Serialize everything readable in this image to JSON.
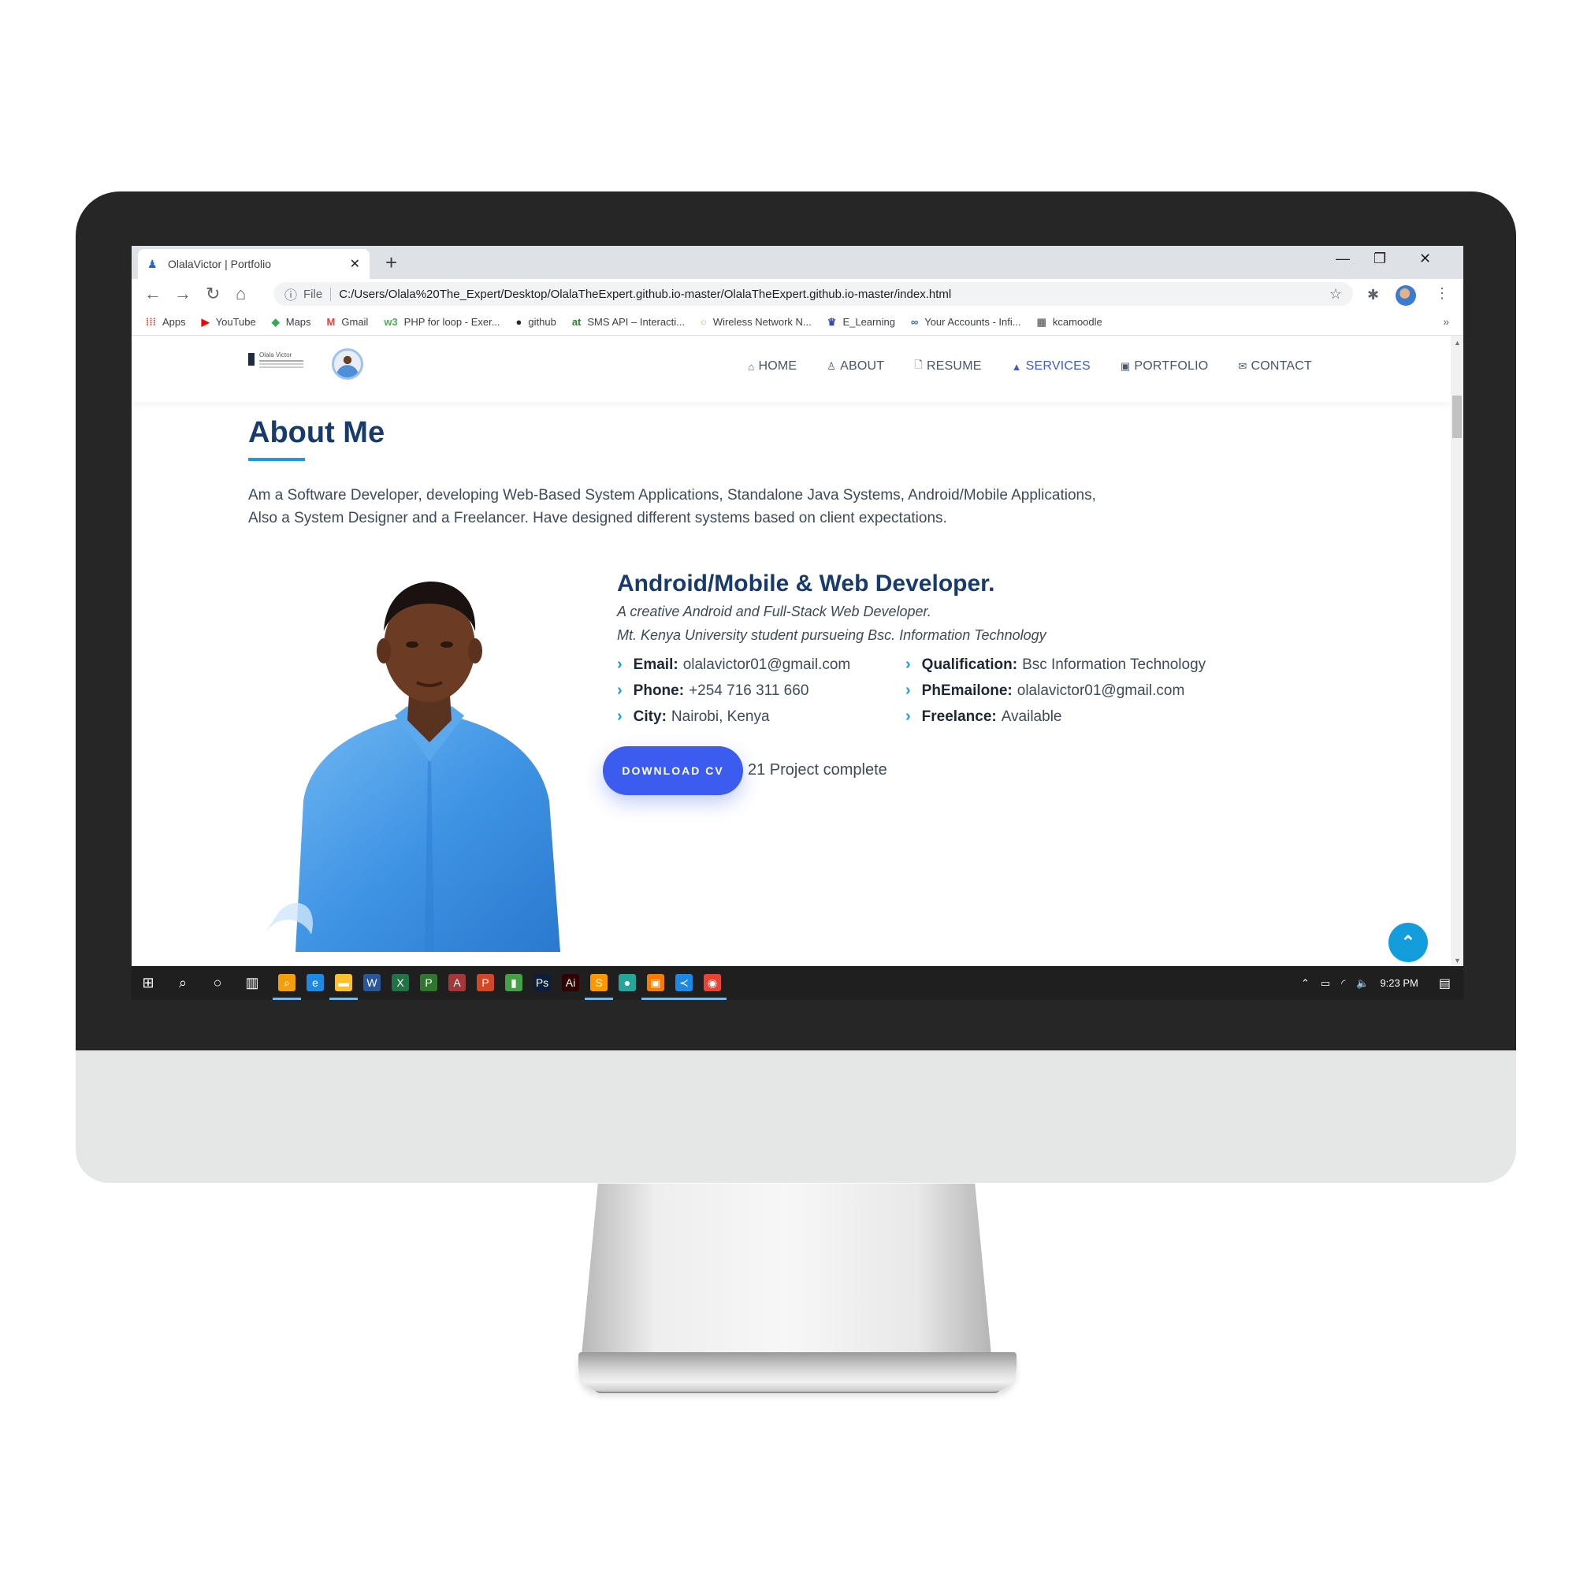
{
  "browser": {
    "tab_title": "OlalaVictor | Portfolio",
    "tab_close": "✕",
    "new_tab": "+",
    "win_minimize": "—",
    "win_restore": "❐",
    "win_close": "✕",
    "back": "←",
    "forward": "→",
    "reload": "↻",
    "home": "⌂",
    "info": "ⓘ",
    "file_label": "File",
    "url": "C:/Users/Olala%20The_Expert/Desktop/OlalaTheExpert.github.io-master/OlalaTheExpert.github.io-master/index.html",
    "star": "☆",
    "extensions": "✱",
    "menu": "⋮",
    "bookmarks_more": "»"
  },
  "bookmarks": [
    {
      "label": "Apps",
      "icon": "apps-grid",
      "glyph": "⁞⁞⁞",
      "color": "#ea4335"
    },
    {
      "label": "YouTube",
      "icon": "youtube-icon",
      "glyph": "▶",
      "color": "#ff0000"
    },
    {
      "label": "Maps",
      "icon": "maps-icon",
      "glyph": "◆",
      "color": "#34a853"
    },
    {
      "label": "Gmail",
      "icon": "gmail-icon",
      "glyph": "M",
      "color": "#ea4335"
    },
    {
      "label": "PHP for loop - Exer...",
      "icon": "w3-icon",
      "glyph": "w3",
      "color": "#4caf50"
    },
    {
      "label": "github",
      "icon": "github-icon",
      "glyph": "●",
      "color": "#24292e"
    },
    {
      "label": "SMS API – Interacti...",
      "icon": "sms-icon",
      "glyph": "at",
      "color": "#2e7d32"
    },
    {
      "label": "Wireless Network N...",
      "icon": "circle-icon",
      "glyph": "○",
      "color": "#f4a261"
    },
    {
      "label": "E_Learning",
      "icon": "elearning-icon",
      "glyph": "♛",
      "color": "#3949ab"
    },
    {
      "label": "Your Accounts - Infi...",
      "icon": "infinity-icon",
      "glyph": "∞",
      "color": "#1565c0"
    },
    {
      "label": "kcamoodle",
      "icon": "moodle-icon",
      "glyph": "▦",
      "color": "#777777"
    }
  ],
  "site": {
    "logo_text": "Olala Victor",
    "nav": [
      {
        "label": "HOME",
        "glyph": "⌂",
        "active": false
      },
      {
        "label": "ABOUT",
        "glyph": "♙",
        "active": false
      },
      {
        "label": "RESUME",
        "glyph": "🗋",
        "active": false
      },
      {
        "label": "SERVICES",
        "glyph": "▲",
        "active": true
      },
      {
        "label": "PORTFOLIO",
        "glyph": "▣",
        "active": false
      },
      {
        "label": "CONTACT",
        "glyph": "✉",
        "active": false
      }
    ],
    "accent": "#149ddd",
    "title_color": "#173b6c",
    "button_color": "#3c5cf0"
  },
  "about": {
    "title": "About Me",
    "description_line1": "Am a Software Developer, developing Web-Based System Applications, Standalone Java Systems, Android/Mobile Applications,",
    "description_line2": "Also a System Designer and a Freelancer. Have designed different systems based on client expectations.",
    "role": "Android/Mobile & Web Developer.",
    "subtitle1": "A creative Android and Full-Stack Web Developer.",
    "subtitle2": "Mt. Kenya University student pursueing Bsc. Information Technology",
    "left_info": [
      {
        "label": "Email:",
        "value": "olalavictor01@gmail.com"
      },
      {
        "label": "Phone:",
        "value": "+254 716 311 660"
      },
      {
        "label": "City:",
        "value": "Nairobi, Kenya"
      }
    ],
    "right_info": [
      {
        "label": "Qualification:",
        "value": "Bsc Information Technology"
      },
      {
        "label": "PhEmailone:",
        "value": "olalavictor01@gmail.com"
      },
      {
        "label": "Freelance:",
        "value": "Available"
      }
    ],
    "download_label": "DOWNLOAD CV",
    "project_text": "21 Project complete"
  },
  "back_to_top": "⌃",
  "taskbar": {
    "time": "9:23 PM",
    "start_glyph": "⊞",
    "search_glyph": "⌕",
    "cortana_glyph": "○",
    "taskview_glyph": "▥",
    "tray_up": "⌃",
    "battery": "▭",
    "wifi": "◜",
    "volume": "🔈",
    "notification": "▤",
    "apps": [
      {
        "name": "search-app-icon",
        "glyph": "⌕",
        "color": "#f59e0b"
      },
      {
        "name": "edge-icon",
        "glyph": "e",
        "color": "#1e88e5"
      },
      {
        "name": "file-explorer-icon",
        "glyph": "▬",
        "color": "#fbc02d"
      },
      {
        "name": "word-icon",
        "glyph": "W",
        "color": "#2b579a"
      },
      {
        "name": "excel-icon",
        "glyph": "X",
        "color": "#217346"
      },
      {
        "name": "project-icon",
        "glyph": "P",
        "color": "#31752f"
      },
      {
        "name": "access-icon",
        "glyph": "A",
        "color": "#a4373a"
      },
      {
        "name": "powerpoint-icon",
        "glyph": "P",
        "color": "#d24726"
      },
      {
        "name": "green-app-icon",
        "glyph": "▮",
        "color": "#43a047"
      },
      {
        "name": "photoshop-icon",
        "glyph": "Ps",
        "color": "#0b1e3a"
      },
      {
        "name": "illustrator-icon",
        "glyph": "Ai",
        "color": "#330000"
      },
      {
        "name": "sublime-icon",
        "glyph": "S",
        "color": "#ff9800"
      },
      {
        "name": "green-circle-icon",
        "glyph": "●",
        "color": "#26a69a"
      },
      {
        "name": "orange-app-icon",
        "glyph": "▣",
        "color": "#f57c00"
      },
      {
        "name": "vscode-icon",
        "glyph": "≺",
        "color": "#1e88e5"
      },
      {
        "name": "chrome-icon",
        "glyph": "◉",
        "color": "#ea4335"
      }
    ]
  }
}
